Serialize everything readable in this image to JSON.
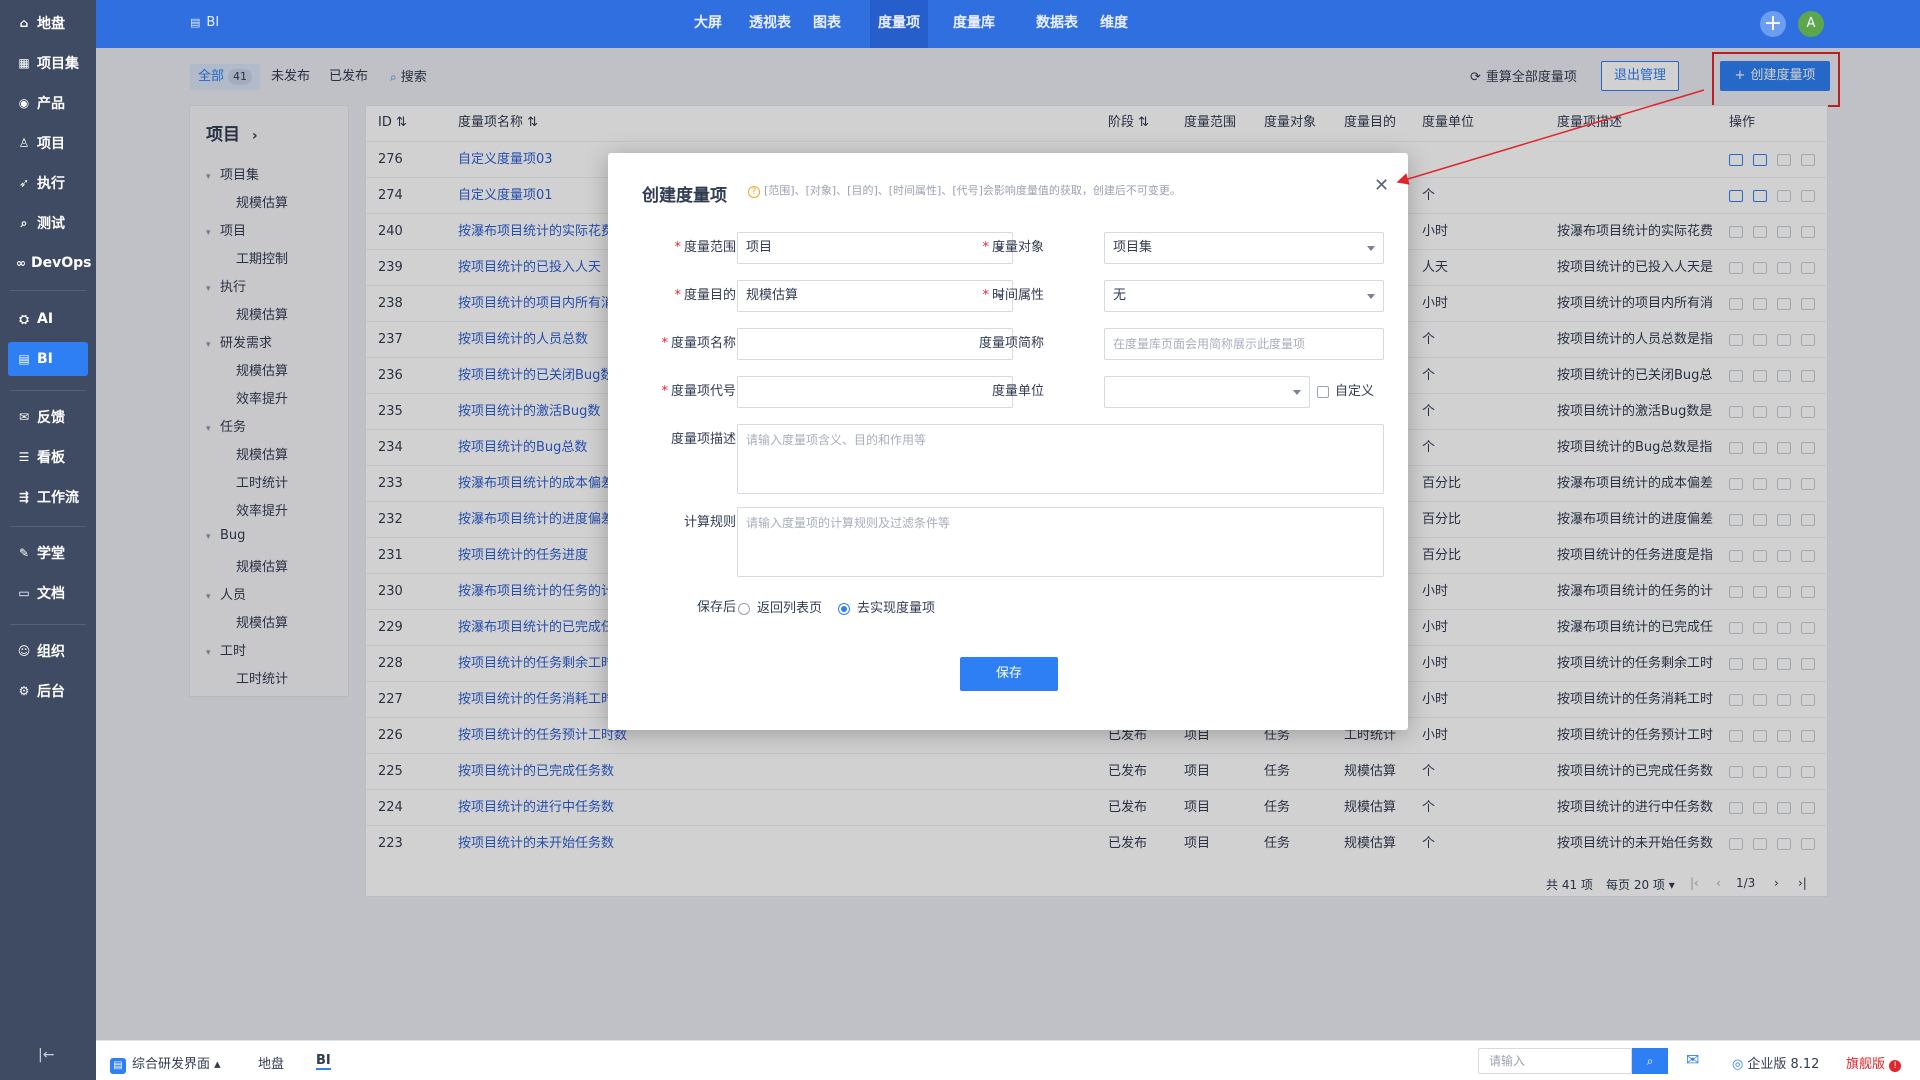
{
  "sidebar": {
    "items": [
      {
        "label": "地盘",
        "icon": "home-icon",
        "glyph": "⌂"
      },
      {
        "label": "项目集",
        "icon": "grid-icon",
        "glyph": "▦"
      },
      {
        "label": "产品",
        "icon": "location-icon",
        "glyph": "◉"
      },
      {
        "label": "项目",
        "icon": "person-icon",
        "glyph": "♙"
      },
      {
        "label": "执行",
        "icon": "run-icon",
        "glyph": "➶"
      },
      {
        "label": "测试",
        "icon": "search-icon",
        "glyph": "⌕"
      },
      {
        "label": "DevOps",
        "icon": "infinity-icon",
        "glyph": "∞"
      },
      {
        "label": "AI",
        "icon": "robot-icon",
        "glyph": "⛭"
      },
      {
        "label": "BI",
        "icon": "chart-icon",
        "glyph": "▤"
      },
      {
        "label": "反馈",
        "icon": "feedback-icon",
        "glyph": "✉"
      },
      {
        "label": "看板",
        "icon": "board-icon",
        "glyph": "☰"
      },
      {
        "label": "工作流",
        "icon": "workflow-icon",
        "glyph": "⇶"
      },
      {
        "label": "学堂",
        "icon": "school-icon",
        "glyph": "✎"
      },
      {
        "label": "文档",
        "icon": "document-icon",
        "glyph": "▭"
      },
      {
        "label": "组织",
        "icon": "team-icon",
        "glyph": "☺"
      },
      {
        "label": "后台",
        "icon": "settings-icon",
        "glyph": "⚙"
      }
    ],
    "collapse_glyph": "|←"
  },
  "header": {
    "app_title": "BI",
    "nav": [
      "大屏",
      "透视表",
      "图表",
      "度量项",
      "度量库",
      "数据表",
      "维度"
    ],
    "active_nav": "度量项",
    "add_glyph": "+",
    "avatar": "A"
  },
  "toolbar": {
    "tabs": [
      {
        "label": "全部",
        "count": "41"
      },
      {
        "label": "未发布"
      },
      {
        "label": "已发布"
      }
    ],
    "search_label": "搜索",
    "recalc_label": "重算全部度量项",
    "exit_label": "退出管理",
    "create_label": "创建度量项"
  },
  "tree": {
    "title": "项目",
    "nodes": [
      {
        "label": "项目集",
        "level": 0
      },
      {
        "label": "规模估算",
        "level": 1
      },
      {
        "label": "项目",
        "level": 0
      },
      {
        "label": "工期控制",
        "level": 1
      },
      {
        "label": "执行",
        "level": 0
      },
      {
        "label": "规模估算",
        "level": 1
      },
      {
        "label": "研发需求",
        "level": 0
      },
      {
        "label": "规模估算",
        "level": 1
      },
      {
        "label": "效率提升",
        "level": 1
      },
      {
        "label": "任务",
        "level": 0
      },
      {
        "label": "规模估算",
        "level": 1
      },
      {
        "label": "工时统计",
        "level": 1
      },
      {
        "label": "效率提升",
        "level": 1
      },
      {
        "label": "Bug",
        "level": 0
      },
      {
        "label": "规模估算",
        "level": 1
      },
      {
        "label": "人员",
        "level": 0
      },
      {
        "label": "规模估算",
        "level": 1
      },
      {
        "label": "工时",
        "level": 0
      },
      {
        "label": "工时统计",
        "level": 1
      }
    ]
  },
  "table": {
    "headers": [
      "ID",
      "度量项名称",
      "阶段",
      "度量范围",
      "度量对象",
      "度量目的",
      "度量单位",
      "度量项描述",
      "操作"
    ],
    "rows": [
      {
        "id": "276",
        "name": "自定义度量项03",
        "stage": "",
        "scope": "",
        "object": "",
        "purpose": "",
        "unit": "",
        "desc": ""
      },
      {
        "id": "274",
        "name": "自定义度量项01",
        "stage": "",
        "scope": "",
        "object": "",
        "purpose": "",
        "unit": "个",
        "desc": ""
      },
      {
        "id": "240",
        "name": "按瀑布项目统计的实际花费",
        "stage": "",
        "scope": "",
        "object": "",
        "purpose": "",
        "unit": "小时",
        "desc": "按瀑布项目统计的实际花费"
      },
      {
        "id": "239",
        "name": "按项目统计的已投入人天",
        "stage": "",
        "scope": "",
        "object": "",
        "purpose": "",
        "unit": "人天",
        "desc": "按项目统计的已投入人天是"
      },
      {
        "id": "238",
        "name": "按项目统计的项目内所有消",
        "stage": "",
        "scope": "",
        "object": "",
        "purpose": "",
        "unit": "小时",
        "desc": "按项目统计的项目内所有消"
      },
      {
        "id": "237",
        "name": "按项目统计的人员总数",
        "stage": "",
        "scope": "",
        "object": "",
        "purpose": "",
        "unit": "个",
        "desc": "按项目统计的人员总数是指"
      },
      {
        "id": "236",
        "name": "按项目统计的已关闭Bug数",
        "stage": "",
        "scope": "",
        "object": "",
        "purpose": "",
        "unit": "个",
        "desc": "按项目统计的已关闭Bug总"
      },
      {
        "id": "235",
        "name": "按项目统计的激活Bug数",
        "stage": "",
        "scope": "",
        "object": "",
        "purpose": "",
        "unit": "个",
        "desc": "按项目统计的激活Bug数是"
      },
      {
        "id": "234",
        "name": "按项目统计的Bug总数",
        "stage": "",
        "scope": "",
        "object": "",
        "purpose": "",
        "unit": "个",
        "desc": "按项目统计的Bug总数是指"
      },
      {
        "id": "233",
        "name": "按瀑布项目统计的成本偏差",
        "stage": "",
        "scope": "",
        "object": "",
        "purpose": "",
        "unit": "百分比",
        "desc": "按瀑布项目统计的成本偏差"
      },
      {
        "id": "232",
        "name": "按瀑布项目统计的进度偏差",
        "stage": "",
        "scope": "",
        "object": "",
        "purpose": "",
        "unit": "百分比",
        "desc": "按瀑布项目统计的进度偏差"
      },
      {
        "id": "231",
        "name": "按项目统计的任务进度",
        "stage": "",
        "scope": "",
        "object": "",
        "purpose": "",
        "unit": "百分比",
        "desc": "按项目统计的任务进度是指"
      },
      {
        "id": "230",
        "name": "按瀑布项目统计的任务的计",
        "stage": "",
        "scope": "",
        "object": "",
        "purpose": "",
        "unit": "小时",
        "desc": "按瀑布项目统计的任务的计"
      },
      {
        "id": "229",
        "name": "按瀑布项目统计的已完成任",
        "stage": "",
        "scope": "",
        "object": "",
        "purpose": "",
        "unit": "小时",
        "desc": "按瀑布项目统计的已完成任"
      },
      {
        "id": "228",
        "name": "按项目统计的任务剩余工时",
        "stage": "",
        "scope": "",
        "object": "",
        "purpose": "",
        "unit": "小时",
        "desc": "按项目统计的任务剩余工时"
      },
      {
        "id": "227",
        "name": "按项目统计的任务消耗工时",
        "stage": "",
        "scope": "",
        "object": "",
        "purpose": "",
        "unit": "小时",
        "desc": "按项目统计的任务消耗工时"
      },
      {
        "id": "226",
        "name": "按项目统计的任务预计工时数",
        "stage": "已发布",
        "scope": "项目",
        "object": "任务",
        "purpose": "工时统计",
        "unit": "小时",
        "desc": "按项目统计的任务预计工时"
      },
      {
        "id": "225",
        "name": "按项目统计的已完成任务数",
        "stage": "已发布",
        "scope": "项目",
        "object": "任务",
        "purpose": "规模估算",
        "unit": "个",
        "desc": "按项目统计的已完成任务数"
      },
      {
        "id": "224",
        "name": "按项目统计的进行中任务数",
        "stage": "已发布",
        "scope": "项目",
        "object": "任务",
        "purpose": "规模估算",
        "unit": "个",
        "desc": "按项目统计的进行中任务数"
      },
      {
        "id": "223",
        "name": "按项目统计的未开始任务数",
        "stage": "已发布",
        "scope": "项目",
        "object": "任务",
        "purpose": "规模估算",
        "unit": "个",
        "desc": "按项目统计的未开始任务数"
      }
    ],
    "pager": {
      "total": "共 41 项",
      "per_page": "每页 20 项",
      "page": "1/3"
    }
  },
  "modal": {
    "title": "创建度量项",
    "hint": "[范围]、[对象]、[目的]、[时间属性]、[代号]会影响度量值的获取，创建后不可变更。",
    "fields": {
      "scope_label": "度量范围",
      "scope_value": "项目",
      "object_label": "度量对象",
      "object_value": "项目集",
      "purpose_label": "度量目的",
      "purpose_value": "规模估算",
      "time_label": "时间属性",
      "time_value": "无",
      "name_label": "度量项名称",
      "name_value": "",
      "alias_label": "度量项简称",
      "alias_placeholder": "在度量库页面会用简称展示此度量项",
      "code_label": "度量项代号",
      "code_value": "",
      "unit_label": "度量单位",
      "unit_value": "",
      "custom_label": "自定义",
      "desc_label": "度量项描述",
      "desc_placeholder": "请输入度量项含义、目的和作用等",
      "rule_label": "计算规则",
      "rule_placeholder": "请输入度量项的计算规则及过滤条件等"
    },
    "after_save_label": "保存后",
    "radio_options": [
      "返回列表页",
      "去实现度量项"
    ],
    "radio_selected": "去实现度量项",
    "save_label": "保存"
  },
  "bottombar": {
    "workspace": "综合研发界面",
    "tabs": [
      "地盘",
      "BI"
    ],
    "active_tab": "BI",
    "search_placeholder": "请输入",
    "edition": "企业版 8.12",
    "flagship": "旗舰版"
  }
}
